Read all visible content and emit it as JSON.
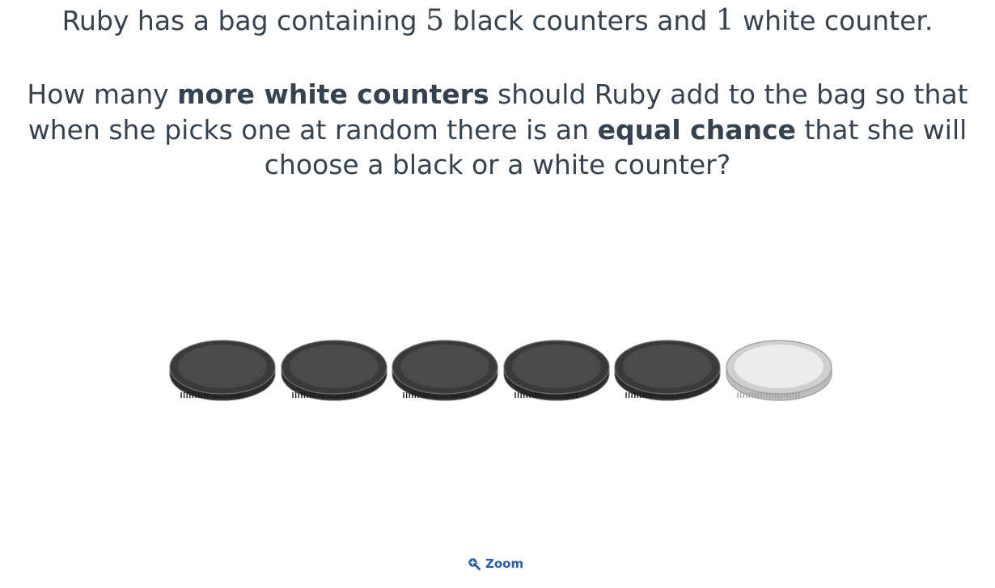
{
  "question": {
    "intro": {
      "before": "Ruby has a bag containing ",
      "black_count": "5",
      "middle": " black counters and ",
      "white_count": "1",
      "after": " white counter."
    },
    "main": {
      "part1": "How many ",
      "bold1": "more white counters",
      "part2": " should Ruby add to the bag so that when she picks one at random there is an ",
      "bold2": "equal chance",
      "part3": " that she will choose a black or a white counter?"
    }
  },
  "counters": [
    {
      "color": "black"
    },
    {
      "color": "black"
    },
    {
      "color": "black"
    },
    {
      "color": "black"
    },
    {
      "color": "black"
    },
    {
      "color": "white"
    }
  ],
  "counter_colors": {
    "black": {
      "edge": "#3a3a3a",
      "top": "#4a4a4a",
      "rim": "#2b2b2b",
      "stroke": "#6e6e6e"
    },
    "white": {
      "edge": "#cfcfcf",
      "top": "#ececec",
      "rim": "#bdbdbd",
      "stroke": "#9a9a9a"
    }
  },
  "zoom": {
    "label": "Zoom",
    "icon": "zoom-in-icon",
    "color": "#2a5db0"
  }
}
